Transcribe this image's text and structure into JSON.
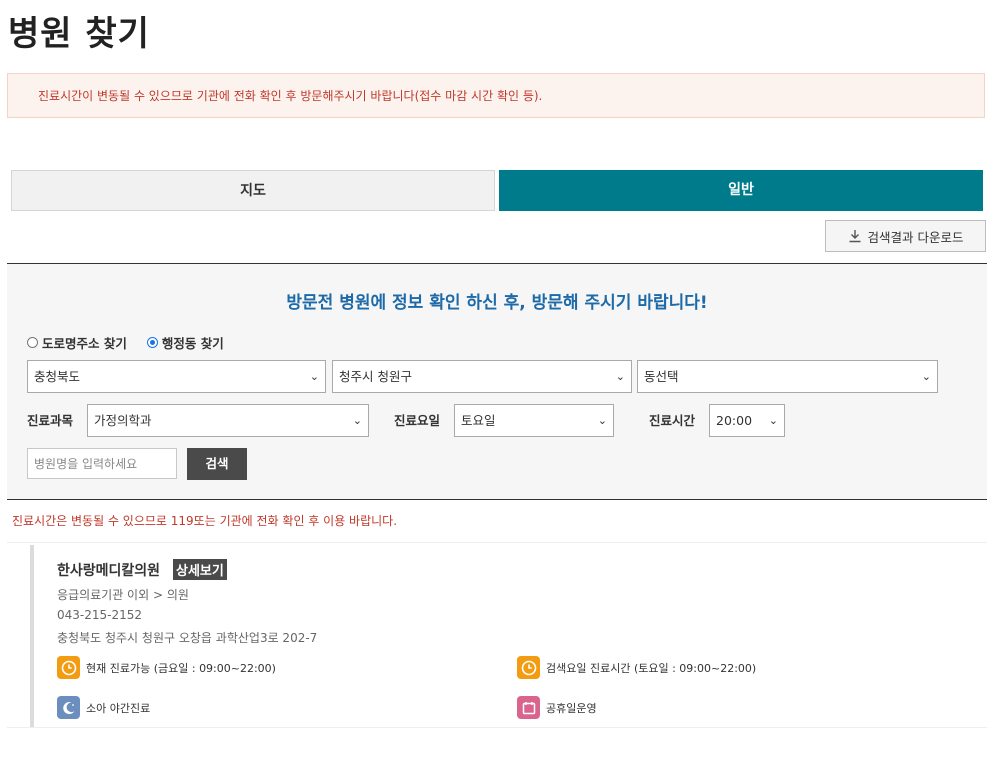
{
  "page": {
    "title": "병원 찾기"
  },
  "notice": {
    "text": "진료시간이 변동될 수 있으므로 기관에 전화 확인 후 방문해주시기 바랍니다(접수 마감 시간 확인 등)."
  },
  "tabs": [
    {
      "label": "지도",
      "active": false
    },
    {
      "label": "일반",
      "active": true
    }
  ],
  "download": {
    "label": "검색결과 다운로드",
    "icon": "download-icon"
  },
  "search": {
    "heading": "방문전 병원에 정보 확인 하신 후, 방문해 주시기 바랍니다!",
    "radio_road": "도로명주소 찾기",
    "radio_admin": "행정동 찾기",
    "selected_radio": "행정동 찾기",
    "province": "충청북도",
    "city": "청주시 청원구",
    "dong": "동선택",
    "dept_label": "진료과목",
    "dept_value": "가정의학과",
    "day_label": "진료요일",
    "day_value": "토요일",
    "time_label": "진료시간",
    "time_value": "20:00",
    "name_placeholder": "병원명을 입력하세요",
    "search_label": "검색"
  },
  "warning": {
    "text": "진료시간은 변동될 수 있으므로 119또는 기관에 전화 확인 후 이용 바랍니다."
  },
  "result": {
    "name": "한사랑메디칼의원",
    "detail_label": "상세보기",
    "category": "응급의료기관 이외 > 의원",
    "phone": "043-215-2152",
    "address": "충청북도 청주시 청원구 오창읍 과학산업3로 202-7",
    "status_now": "현재 진료가능 (금요일 : 09:00~22:00)",
    "status_search": "검색요일 진료시간 (토요일 : 09:00~22:00)",
    "pediatric": "소아 야간진료",
    "holiday": "공휴일운영"
  },
  "colors": {
    "accent": "#007b8c",
    "heading_blue": "#1d6aa8",
    "warning_red": "#c0392b",
    "clock_orange": "#f39c12",
    "moon_blue": "#6c8ebf",
    "calendar_pink": "#d9648e"
  }
}
